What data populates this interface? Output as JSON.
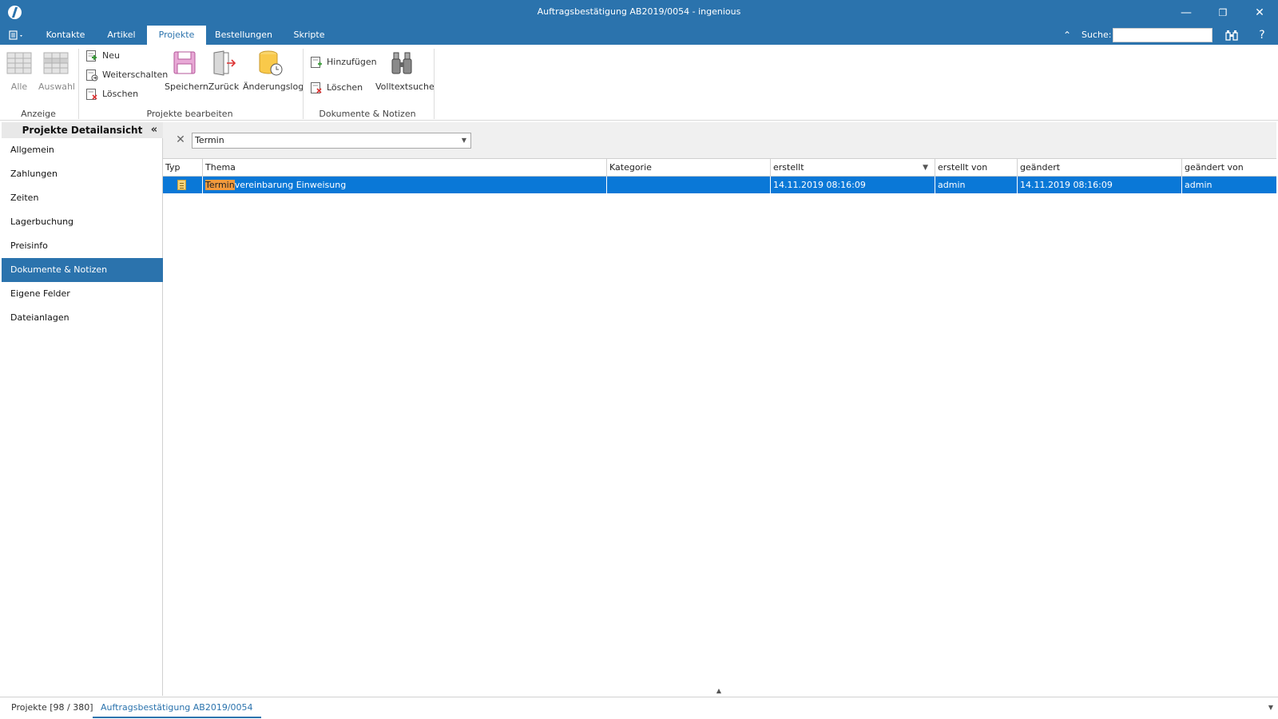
{
  "window": {
    "title": "Auftragsbestätigung AB2019/0054 - ingenious",
    "minimize": "—",
    "maximize": "❐",
    "close": "✕"
  },
  "menu": {
    "tabs": [
      {
        "label": "Kontakte"
      },
      {
        "label": "Artikel"
      },
      {
        "label": "Projekte",
        "active": true
      },
      {
        "label": "Bestellungen"
      },
      {
        "label": "Skripte"
      }
    ],
    "search_label": "Suche:",
    "search_value": "",
    "help": "?"
  },
  "ribbon": {
    "groups": {
      "anzeige": "Anzeige",
      "projekte_bearbeiten": "Projekte bearbeiten",
      "dokumente_notizen": "Dokumente & Notizen"
    },
    "buttons": {
      "alle": "Alle",
      "auswahl": "Auswahl",
      "neu": "Neu",
      "weiterschalten": "Weiterschalten",
      "loeschen": "Löschen",
      "speichern": "Speichern",
      "zurueck": "Zurück",
      "aenderungslog": "Änderungslog",
      "hinzufuegen": "Hinzufügen",
      "loeschen2": "Löschen",
      "volltextsuche": "Volltextsuche"
    }
  },
  "sidebar": {
    "title": "Projekte Detailansicht",
    "items": [
      {
        "label": "Allgemein"
      },
      {
        "label": "Zahlungen"
      },
      {
        "label": "Zeiten"
      },
      {
        "label": "Lagerbuchung"
      },
      {
        "label": "Preisinfo"
      },
      {
        "label": "Dokumente & Notizen",
        "active": true
      },
      {
        "label": "Eigene Felder"
      },
      {
        "label": "Dateianlagen"
      }
    ]
  },
  "filter": {
    "value": "Termin"
  },
  "grid": {
    "columns": [
      "Typ",
      "Thema",
      "Kategorie",
      "erstellt",
      "erstellt von",
      "geändert",
      "geändert von"
    ],
    "rows": [
      {
        "thema_highlight": "Termin",
        "thema_rest": "vereinbarung Einweisung",
        "kategorie": "",
        "erstellt": "14.11.2019 08:16:09",
        "erstellt_von": "admin",
        "geaendert": "14.11.2019 08:16:09",
        "geaendert_von": "admin"
      }
    ]
  },
  "bottom_tabs": [
    {
      "label": "Projekte [98 / 380]"
    },
    {
      "label": "Auftragsbestätigung AB2019/0054",
      "active": true
    }
  ],
  "colors": {
    "accent": "#2b73ad",
    "selection": "#0a78d7",
    "highlight": "#f39a3d"
  }
}
